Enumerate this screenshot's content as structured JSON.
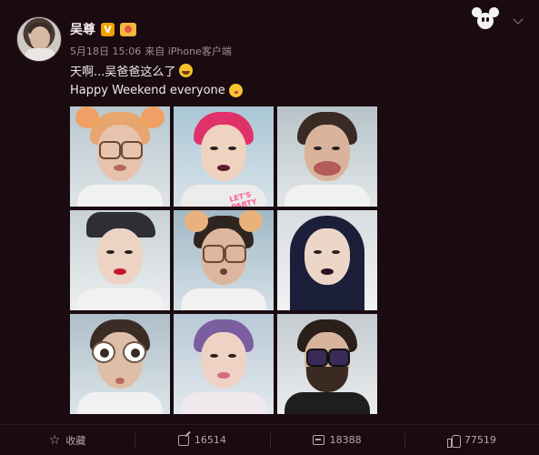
{
  "post": {
    "username": "吴尊",
    "verified_badge": "V",
    "date": "5月18日 15:06",
    "source": "来自 iPhone客户端",
    "line1": "天啊...吴爸爸这么了",
    "line2": "Happy Weekend everyone",
    "sticker_text": "LET'S PARTY"
  },
  "icons": {
    "header": [
      "avatar",
      "verified-icon",
      "vip-icon",
      "mickey-icon",
      "chevron-down-icon"
    ],
    "actions": [
      "star-icon",
      "share-icon",
      "comment-icon",
      "like-icon"
    ]
  },
  "actions": {
    "collect_label": "收藏",
    "repost_count": "16514",
    "comment_count": "18388",
    "like_count": "77519"
  },
  "colors": {
    "background": "#1a0b10",
    "verified": "#f0a000",
    "text": "#efe8ea",
    "muted": "#9c8f94"
  }
}
